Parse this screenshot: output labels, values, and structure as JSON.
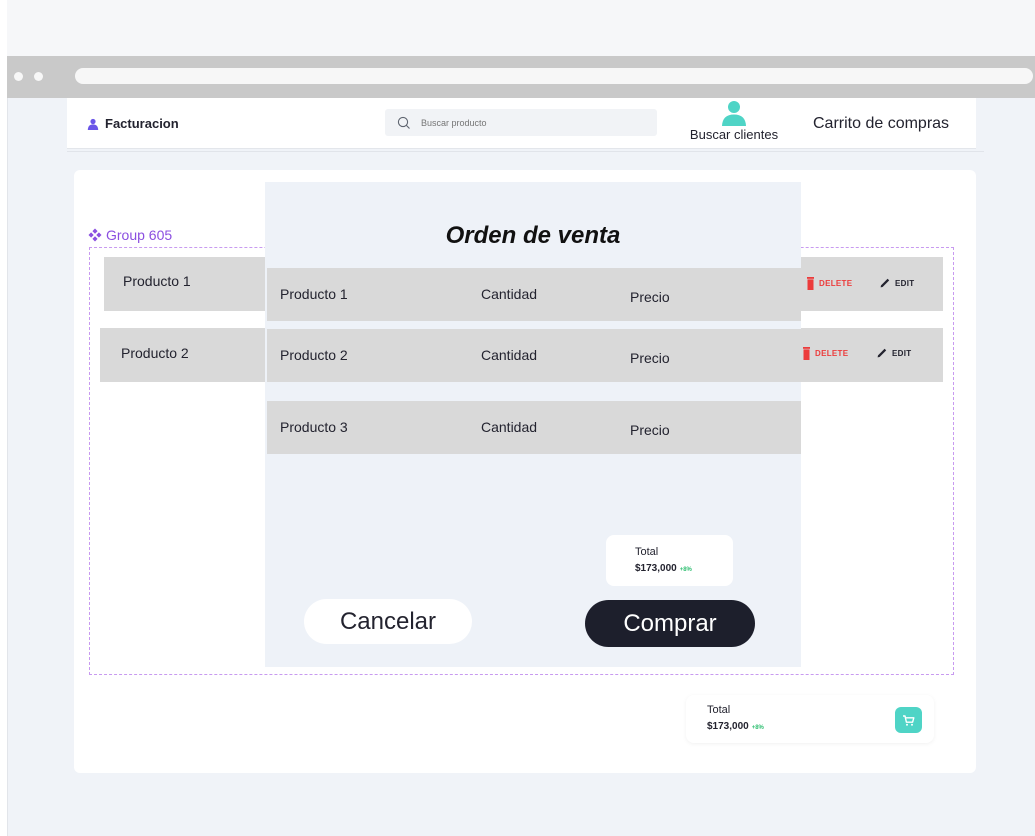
{
  "header": {
    "brand": "Facturacion",
    "search_placeholder": "Buscar producto",
    "clients_label": "Buscar clientes",
    "cart_link": "Carrito de compras"
  },
  "group": {
    "label": "Group 605"
  },
  "product_list": [
    {
      "name": "Producto 1",
      "delete_label": "DELETE",
      "edit_label": "EDIT"
    },
    {
      "name": "Producto 2",
      "delete_label": "DELETE",
      "edit_label": "EDIT"
    }
  ],
  "modal": {
    "title": "Orden de venta",
    "rows": [
      {
        "product": "Producto 1",
        "quantity": "Cantidad",
        "price": "Precio"
      },
      {
        "product": "Producto 2",
        "quantity": "Cantidad",
        "price": "Precio"
      },
      {
        "product": "Producto 3",
        "quantity": "Cantidad",
        "price": "Precio"
      }
    ],
    "total": {
      "title": "Total",
      "amount": "$173,000",
      "change": "+8%"
    },
    "cancel_label": "Cancelar",
    "buy_label": "Comprar"
  },
  "footer_total": {
    "title": "Total",
    "amount": "$173,000",
    "change": "+8%"
  },
  "icons": {
    "brand": "user-icon",
    "search": "search-icon",
    "clients": "person-icon",
    "group": "component-icon",
    "delete": "trash-icon",
    "edit": "pencil-icon",
    "cart": "cart-icon"
  },
  "colors": {
    "accent_purple": "#8b4fe0",
    "delete_red": "#ec3b3b",
    "teal": "#4fd4c6",
    "buy_button": "#1d1f2c",
    "positive_green": "#2fbf71",
    "row_gray": "#d9d9d9"
  }
}
